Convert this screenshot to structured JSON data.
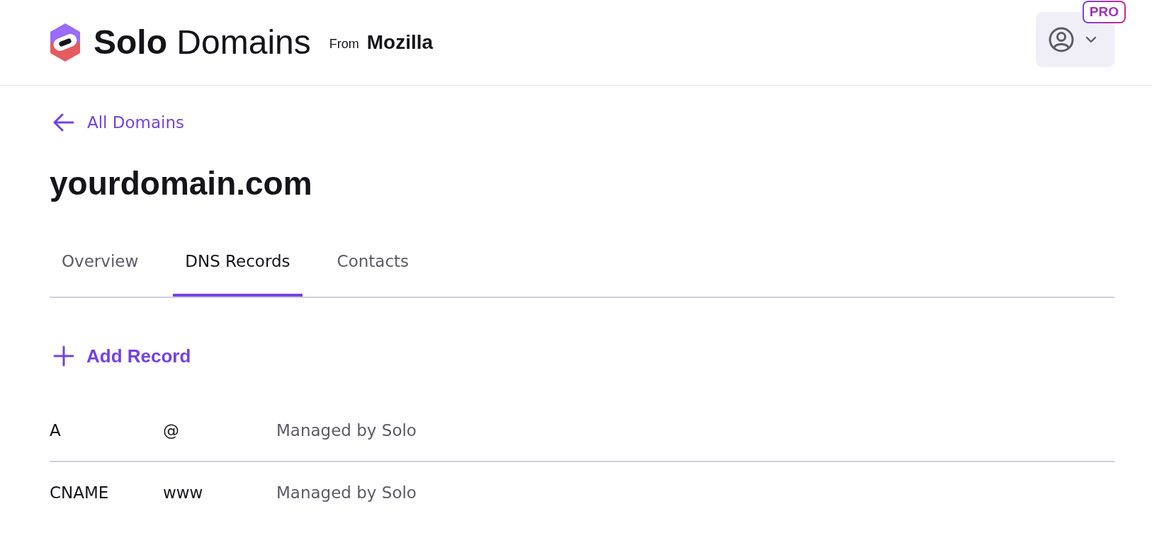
{
  "header": {
    "logo": {
      "name": "**Solo** Domains",
      "byline": "From",
      "maker": "Mozilla"
    },
    "account": {
      "badge": "PRO"
    }
  },
  "back_link": {
    "label": "All Domains"
  },
  "title": "yourdomain.com",
  "tabs": [
    {
      "label": "Overview",
      "selected": false
    },
    {
      "label": "DNS Records",
      "selected": true
    },
    {
      "label": "Contacts",
      "selected": false
    }
  ],
  "add_button": {
    "label": "Add Record"
  },
  "records": [
    {
      "type": "A",
      "name": "@",
      "value": "Managed by Solo"
    },
    {
      "type": "CNAME",
      "name": "www",
      "value": "Managed by Solo"
    }
  ]
}
